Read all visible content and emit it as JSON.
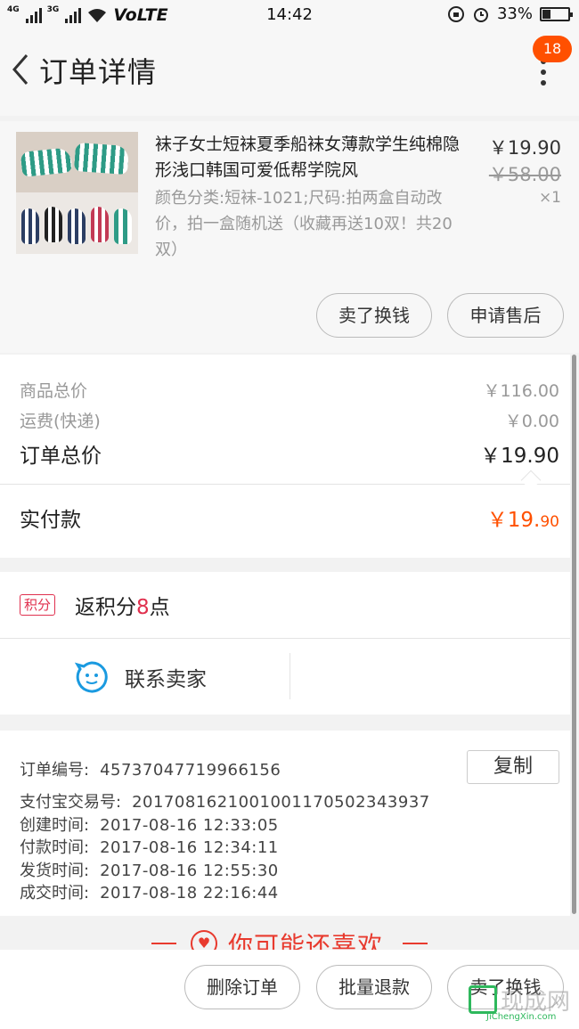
{
  "status_bar": {
    "network_1": "4G",
    "network_2": "3G",
    "volte": "VoLTE",
    "time": "14:42",
    "battery_text": "33%",
    "battery_level": 0.33
  },
  "header": {
    "title": "订单详情",
    "badge_count": "18"
  },
  "product": {
    "name": "袜子女士短袜夏季船袜女薄款学生纯棉隐形浅口韩国可爱低帮学院风",
    "spec": "颜色分类:短袜-1021;尺码:拍两盒自动改价，拍一盒随机送（收藏再送10双！共20双）",
    "price": "￥19.90",
    "original_price": "￥58.00",
    "quantity": "×1",
    "buttons": [
      "卖了换钱",
      "申请售后"
    ]
  },
  "summary": {
    "goods_total_label": "商品总价",
    "goods_total_value": "￥116.00",
    "shipping_label": "运费(快递)",
    "shipping_value": "￥0.00",
    "order_total_label": "订单总价",
    "order_total_value": "￥19.90",
    "paid_label": "实付款",
    "paid_value_main": "￥19.",
    "paid_value_cents": "90"
  },
  "points": {
    "badge": "积分",
    "text_before": "返积分",
    "number": "8",
    "text_after": "点"
  },
  "contact": {
    "label": "联系卖家"
  },
  "order_info": {
    "copy_button": "复制",
    "rows": [
      {
        "label": "订单编号:",
        "value": "45737047719966156"
      },
      {
        "label": "支付宝交易号:",
        "value": "2017081621001001170502343937"
      },
      {
        "label": "创建时间:",
        "value": "2017-08-16  12:33:05"
      },
      {
        "label": "付款时间:",
        "value": "2017-08-16  12:34:11"
      },
      {
        "label": "发货时间:",
        "value": "2017-08-16  12:55:30"
      },
      {
        "label": "成交时间:",
        "value": "2017-08-18  22:16:44"
      }
    ]
  },
  "recommend": {
    "title": "你可能还喜欢"
  },
  "bottom_bar": {
    "buttons": [
      "删除订单",
      "批量退款",
      "卖了换钱"
    ]
  },
  "watermark": {
    "cn": "现成网",
    "en": "JiChengXin.com"
  },
  "colors": {
    "accent": "#ff5000",
    "points_red": "#e0304e",
    "contact_blue": "#1a9ae0"
  }
}
